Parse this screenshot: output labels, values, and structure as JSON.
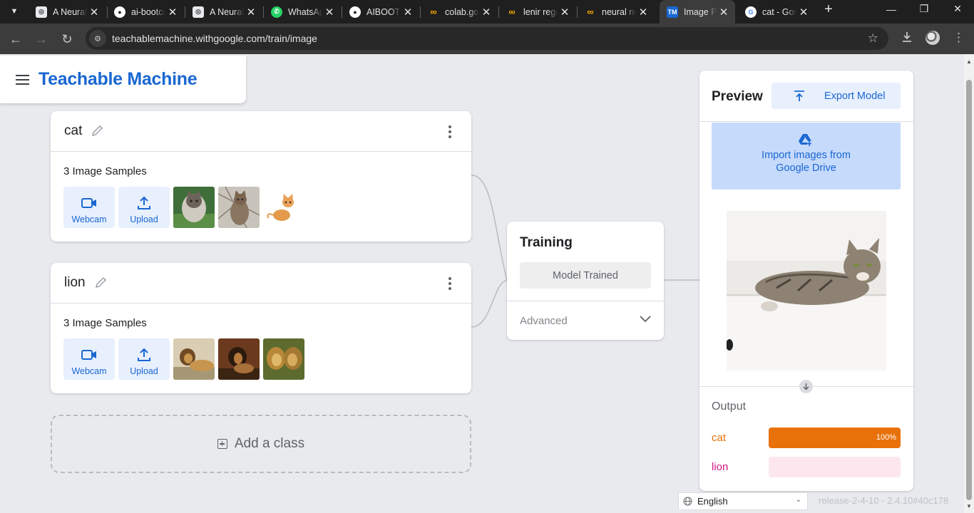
{
  "browser": {
    "tabs": [
      {
        "title": "A Neural Network Playground",
        "favicon": "circle-swirl",
        "color": "#e8eaed"
      },
      {
        "title": "ai-bootcamp",
        "favicon": "github",
        "color": "#ffffff"
      },
      {
        "title": "A Neural Network Playground",
        "favicon": "circle-swirl",
        "color": "#e8eaed"
      },
      {
        "title": "WhatsApp",
        "favicon": "whatsapp",
        "color": "#25d366"
      },
      {
        "title": "AIBOOTCAMP",
        "favicon": "github",
        "color": "#ffffff"
      },
      {
        "title": "colab.google",
        "favicon": "colab",
        "color": "#f9ab00"
      },
      {
        "title": "lenir regression",
        "favicon": "colab",
        "color": "#f9ab00"
      },
      {
        "title": "neural network",
        "favicon": "colab",
        "color": "#f9ab00"
      },
      {
        "title": "Image Project",
        "favicon": "tm",
        "color": "#1967d2",
        "active": true
      },
      {
        "title": "cat - Google Search",
        "favicon": "google",
        "color": "#4285f4"
      }
    ],
    "url": "teachablemachine.withgoogle.com/train/image"
  },
  "app": {
    "brand": "Teachable Machine"
  },
  "classes": [
    {
      "name": "cat",
      "samples_label": "3 Image Samples",
      "webcam_label": "Webcam",
      "upload_label": "Upload"
    },
    {
      "name": "lion",
      "samples_label": "3 Image Samples",
      "webcam_label": "Webcam",
      "upload_label": "Upload"
    }
  ],
  "add_class_label": "Add a class",
  "training": {
    "title": "Training",
    "button_label": "Model Trained",
    "advanced_label": "Advanced"
  },
  "preview": {
    "title": "Preview",
    "export_label": "Export Model",
    "import_label_1": "Import images from",
    "import_label_2": "Google Drive",
    "output_title": "Output",
    "outputs": [
      {
        "label": "cat",
        "percent": 100,
        "percent_text": "100%",
        "color": "#e8710a",
        "track": "#fce8d5"
      },
      {
        "label": "lion",
        "percent": 0,
        "percent_text": "",
        "color": "#d01884",
        "track": "#fde7ee"
      }
    ]
  },
  "footer": {
    "language": "English",
    "release": "release-2-4-10 - 2.4.10#40c178"
  }
}
